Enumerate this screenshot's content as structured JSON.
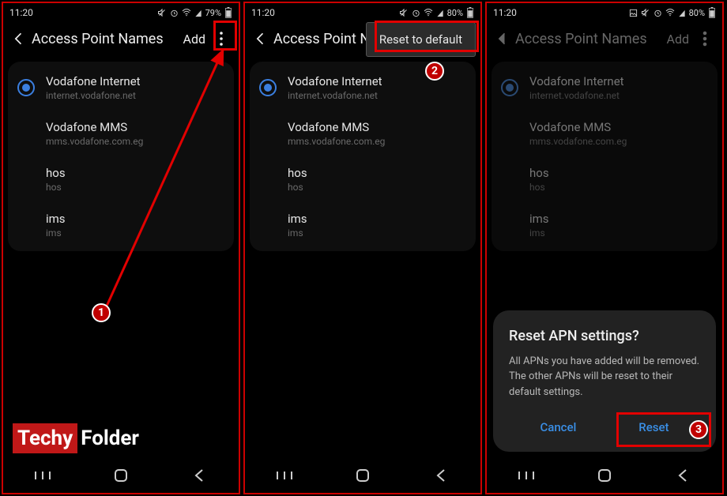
{
  "status": {
    "time": "11:20",
    "battery1": "79%",
    "battery2": "80%",
    "battery3": "80%"
  },
  "appbar": {
    "title": "Access Point Names",
    "add": "Add"
  },
  "apns": [
    {
      "name": "Vodafone Internet",
      "sub": "internet.vodafone.net",
      "selected": true
    },
    {
      "name": "Vodafone MMS",
      "sub": "mms.vodafone.com.eg",
      "selected": false
    },
    {
      "name": "hos",
      "sub": "hos",
      "selected": false
    },
    {
      "name": "ims",
      "sub": "ims",
      "selected": false
    }
  ],
  "menu": {
    "reset": "Reset to default"
  },
  "dialog": {
    "title": "Reset APN settings?",
    "body": "All APNs you have added will be removed. The other APNs will be reset to their default settings.",
    "cancel": "Cancel",
    "reset": "Reset"
  },
  "badges": {
    "one": "1",
    "two": "2",
    "three": "3"
  },
  "logo": {
    "a": "Techy",
    "b": "Folder"
  }
}
